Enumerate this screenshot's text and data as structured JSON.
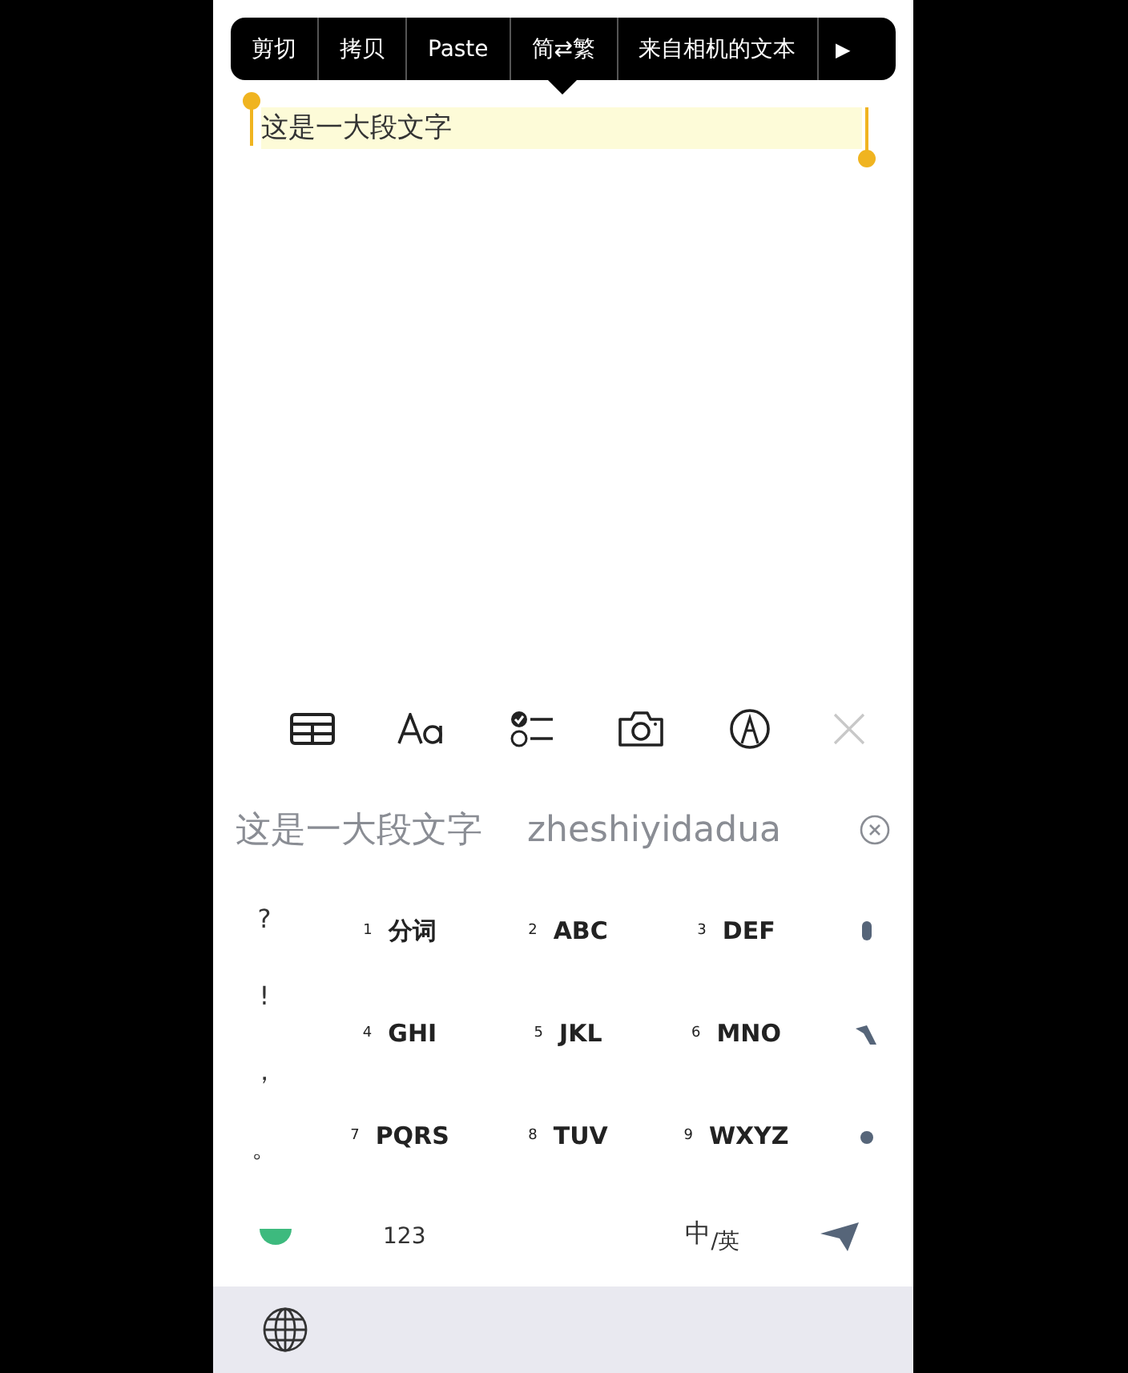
{
  "edit_menu": {
    "items": [
      {
        "label": "剪切"
      },
      {
        "label": "拷贝"
      },
      {
        "label": "Paste"
      },
      {
        "label": "简⇄繁"
      },
      {
        "label": "来自相机的文本"
      }
    ],
    "more": "▶"
  },
  "note": {
    "selected_text": "这是一大段文字"
  },
  "candidates": {
    "items": [
      "这是一大段文字",
      "zheshiyidadua"
    ]
  },
  "keyboard": {
    "punctuation": [
      "?",
      "!",
      "，",
      "。"
    ],
    "keys": [
      {
        "digit": "1",
        "letters": "分词"
      },
      {
        "digit": "2",
        "letters": "ABC"
      },
      {
        "digit": "3",
        "letters": "DEF"
      },
      {
        "digit": "4",
        "letters": "GHI"
      },
      {
        "digit": "5",
        "letters": "JKL"
      },
      {
        "digit": "6",
        "letters": "MNO"
      },
      {
        "digit": "7",
        "letters": "PQRS"
      },
      {
        "digit": "8",
        "letters": "TUV"
      },
      {
        "digit": "9",
        "letters": "WXYZ"
      }
    ],
    "numbers_key": "123",
    "language_key": "中$_{/英}$"
  }
}
